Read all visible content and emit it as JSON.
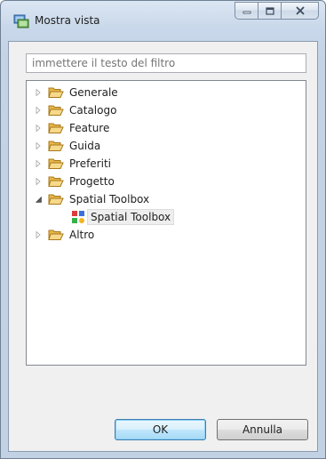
{
  "window": {
    "title": "Mostra vista",
    "icons": {
      "title": "show-view-icon",
      "minimize": "minimize-icon",
      "maximize": "maximize-icon",
      "close": "close-icon"
    }
  },
  "filter": {
    "placeholder": "immettere il testo del filtro"
  },
  "tree": {
    "items": [
      {
        "label": "Generale",
        "expanded": false,
        "icon": "folder-icon"
      },
      {
        "label": "Catalogo",
        "expanded": false,
        "icon": "folder-icon"
      },
      {
        "label": "Feature",
        "expanded": false,
        "icon": "folder-icon"
      },
      {
        "label": "Guida",
        "expanded": false,
        "icon": "folder-icon"
      },
      {
        "label": "Preferiti",
        "expanded": false,
        "icon": "folder-icon"
      },
      {
        "label": "Progetto",
        "expanded": false,
        "icon": "folder-icon"
      },
      {
        "label": "Spatial Toolbox",
        "expanded": true,
        "icon": "folder-icon",
        "children": [
          {
            "label": "Spatial Toolbox",
            "selected": true,
            "icon": "spatial-toolbox-icon"
          }
        ]
      },
      {
        "label": "Altro",
        "expanded": false,
        "icon": "folder-icon"
      }
    ]
  },
  "buttons": {
    "ok": "OK",
    "cancel": "Annulla"
  },
  "colors": {
    "titlebar": "#c9d8ea",
    "client_bg": "#f0f0f0",
    "default_button_border": "#3c7fb1"
  }
}
